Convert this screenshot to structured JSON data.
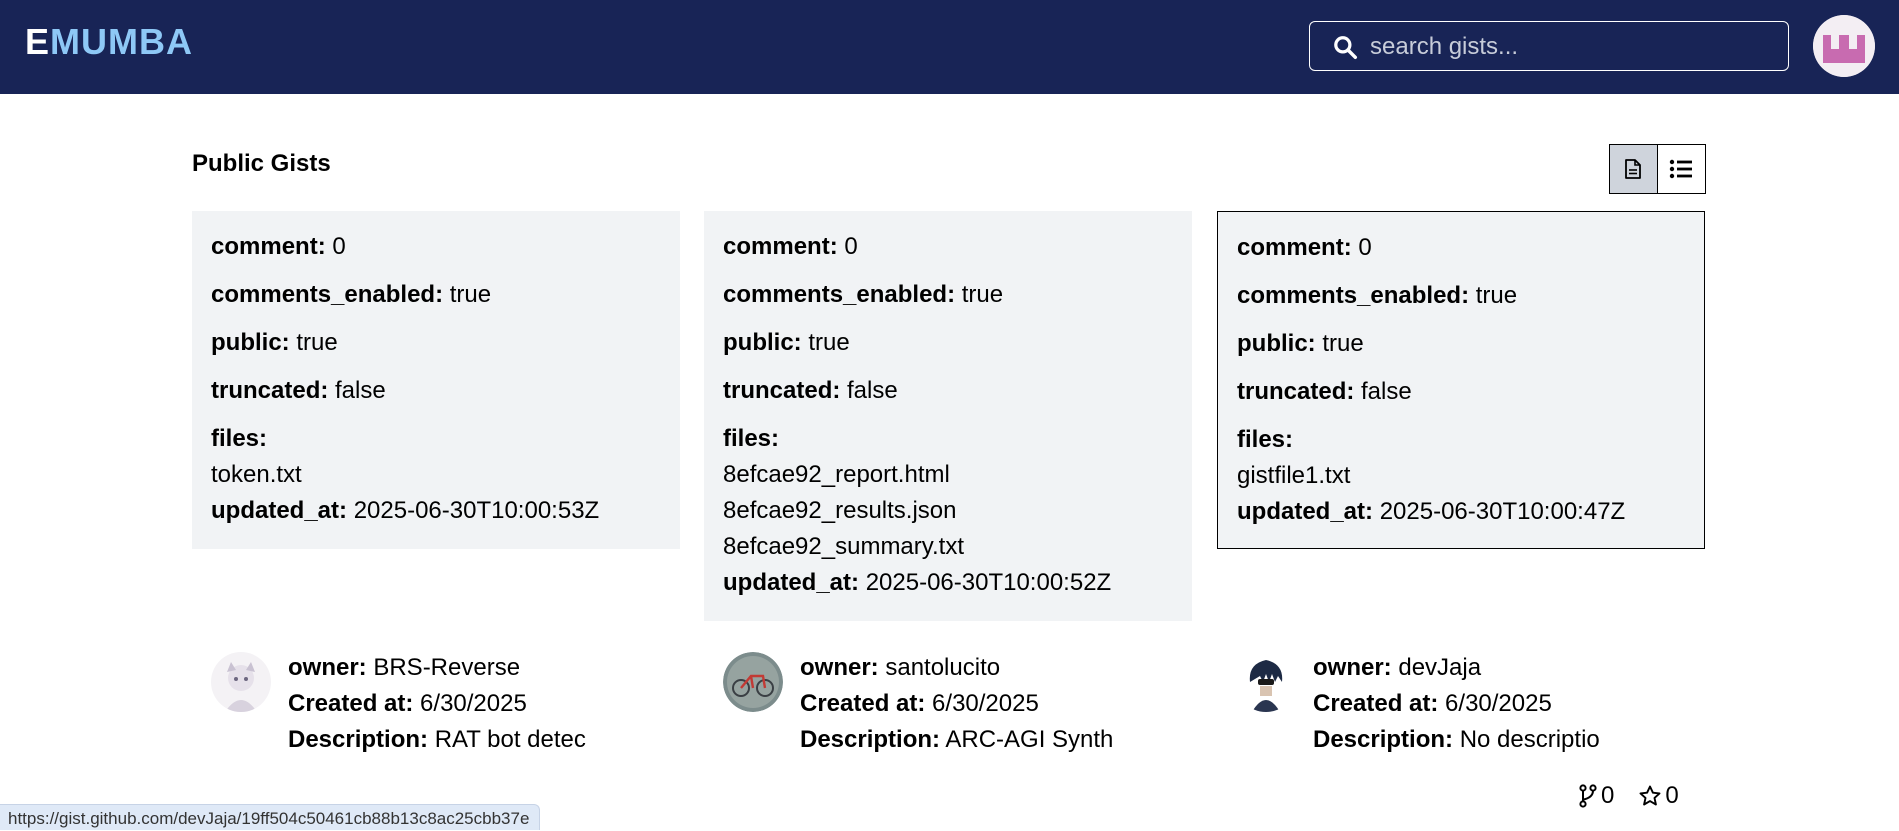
{
  "header": {
    "brand_first": "E",
    "brand_rest": "MUMBA",
    "search_placeholder": "search gists...",
    "icons": {
      "search": "search-icon",
      "user": "user-avatar"
    }
  },
  "main": {
    "title": "Public Gists",
    "view_toggle": [
      {
        "name": "grid-view",
        "icon": "file-icon",
        "active": true
      },
      {
        "name": "list-view",
        "icon": "list-icon",
        "active": false
      }
    ]
  },
  "labels": {
    "comment": "comment:",
    "comments_enabled": "comments_enabled:",
    "public": "public:",
    "truncated": "truncated:",
    "files": "files:",
    "updated_at": "updated_at:",
    "owner": "owner:",
    "created_at": "Created at:",
    "description": "Description:"
  },
  "gists": [
    {
      "comment": "0",
      "comments_enabled": "true",
      "public": "true",
      "truncated": "false",
      "files": [
        "token.txt"
      ],
      "updated_at": "2025-06-30T10:00:53Z",
      "owner": "BRS-Reverse",
      "created_at": "6/30/2025",
      "description": "RAT bot detec"
    },
    {
      "comment": "0",
      "comments_enabled": "true",
      "public": "true",
      "truncated": "false",
      "files": [
        "8efcae92_report.html",
        "8efcae92_results.json",
        "8efcae92_summary.txt"
      ],
      "updated_at": "2025-06-30T10:00:52Z",
      "owner": "santolucito",
      "created_at": "6/30/2025",
      "description": "ARC-AGI Synth"
    },
    {
      "comment": "0",
      "comments_enabled": "true",
      "public": "true",
      "truncated": "false",
      "files": [
        "gistfile1.txt"
      ],
      "updated_at": "2025-06-30T10:00:47Z",
      "owner": "devJaja",
      "created_at": "6/30/2025",
      "description": "No descriptio"
    }
  ],
  "stats": {
    "forks": "0",
    "stars": "0"
  },
  "statusbar": {
    "url": "https://gist.github.com/devJaja/19ff504c50461cb88b13c8ac25cbb37e"
  },
  "colors": {
    "header_bg": "#182456",
    "brand_accent": "#8ec8f6",
    "card_bg": "#f1f3f5"
  }
}
